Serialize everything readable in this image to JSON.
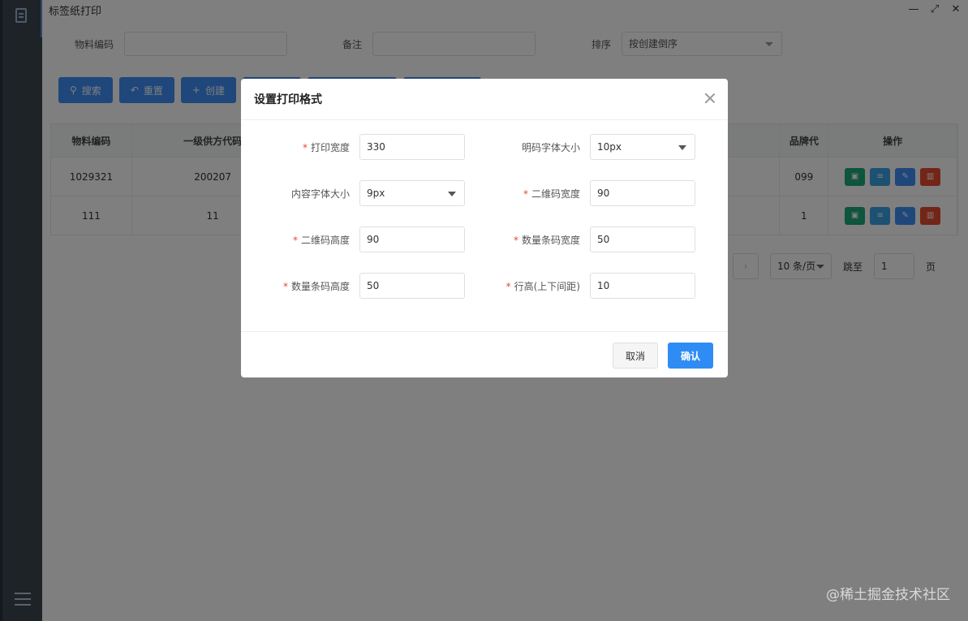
{
  "window": {
    "title": "标签纸打印"
  },
  "filters": {
    "material_code_label": "物料编码",
    "remark_label": "备注",
    "sort_label": "排序",
    "sort_value": "按创建倒序"
  },
  "toolbar": {
    "search": "搜索",
    "reset": "重置",
    "create": "创建"
  },
  "table": {
    "headers": [
      "物料编码",
      "一级供方代码",
      "",
      "品牌代",
      "操作"
    ],
    "rows": [
      {
        "code": "1029321",
        "supplier": "200207",
        "brand": "099"
      },
      {
        "code": "111",
        "supplier": "11",
        "brand": "1"
      }
    ]
  },
  "pager": {
    "page_size": "10 条/页",
    "jump_label": "跳至",
    "jump_value": "1",
    "page_unit": "页"
  },
  "dialog": {
    "title": "设置打印格式",
    "fields": {
      "print_width": {
        "label": "打印宽度",
        "value": "330"
      },
      "plain_font": {
        "label": "明码字体大小",
        "value": "10px"
      },
      "content_font": {
        "label": "内容字体大小",
        "value": "9px"
      },
      "qr_width": {
        "label": "二维码宽度",
        "value": "90"
      },
      "qr_height": {
        "label": "二维码高度",
        "value": "90"
      },
      "qty_bar_width": {
        "label": "数量条码宽度",
        "value": "50"
      },
      "qty_bar_height": {
        "label": "数量条码高度",
        "value": "50"
      },
      "line_height": {
        "label": "行高(上下间距)",
        "value": "10"
      }
    },
    "required_mark": "*",
    "cancel": "取消",
    "confirm": "确认"
  },
  "watermark": "@稀土掘金技术社区",
  "colors": {
    "primary": "#3e8ef7",
    "sidebar": "#3d4651",
    "required": "#e64a2e"
  }
}
